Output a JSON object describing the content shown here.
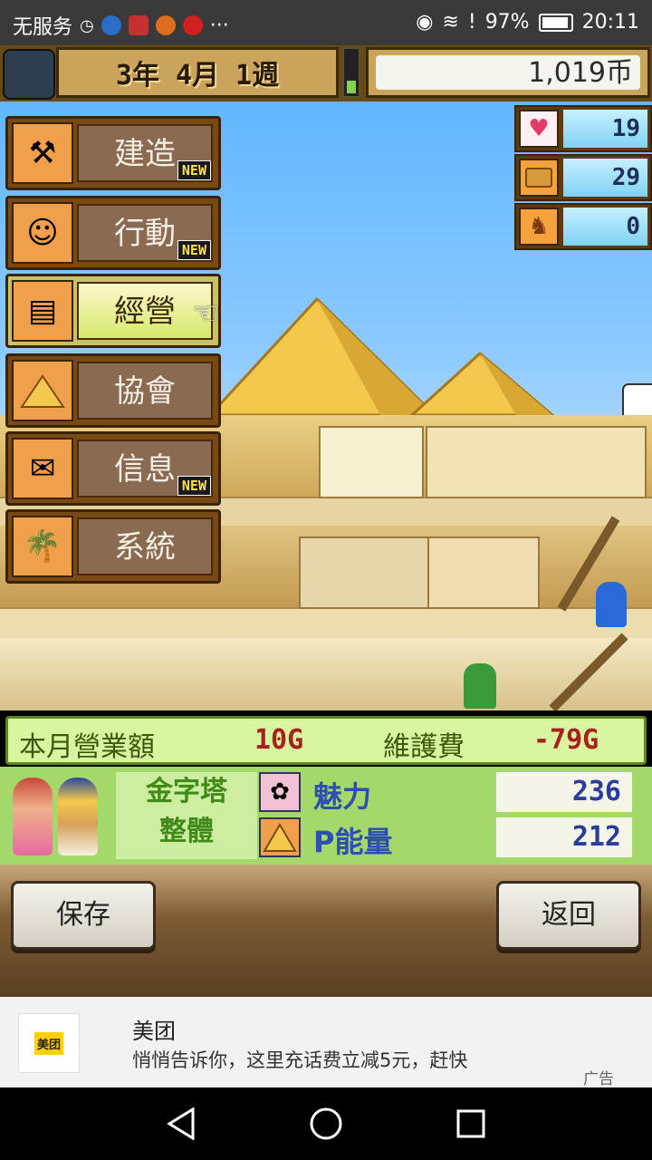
{
  "status_bar": {
    "carrier": "无服务",
    "battery": "97%",
    "time": "20:11",
    "more": "···"
  },
  "header": {
    "date_year": "3年",
    "date_month": "4月",
    "date_week": "1週",
    "coins": "1,019币"
  },
  "stats": [
    {
      "icon": "heart-icon",
      "value": "19"
    },
    {
      "icon": "bread-icon",
      "value": "29"
    },
    {
      "icon": "horse-icon",
      "value": "0"
    }
  ],
  "menu": [
    {
      "label": "建造",
      "new": "NEW",
      "icon": "hammer-icon"
    },
    {
      "label": "行動",
      "new": "NEW",
      "icon": "character-icon"
    },
    {
      "label": "經營",
      "new": "",
      "icon": "scroll-icon"
    },
    {
      "label": "協會",
      "new": "",
      "icon": "pyramid-icon"
    },
    {
      "label": "信息",
      "new": "NEW",
      "icon": "letter-icon"
    },
    {
      "label": "系統",
      "new": "",
      "icon": "island-icon"
    }
  ],
  "revenue": {
    "monthly_label": "本月營業額",
    "monthly_value": "10G",
    "maintenance_label": "維護費",
    "maintenance_value": "-79G"
  },
  "pyramid": {
    "name_line1": "金字塔",
    "name_line2": "整體",
    "charm_label": "魅力",
    "charm_value": "236",
    "energy_label": "P能量",
    "energy_value": "212"
  },
  "buttons": {
    "save": "保存",
    "back": "返回"
  },
  "ad": {
    "logo": "美团",
    "title": "美团",
    "text": "悄悄告诉你，这里充话费立减5元，赶快",
    "tag": "广告"
  },
  "colors": {
    "sky": "#62b7ff",
    "menu_brown": "#7a4a14",
    "active_yellow": "#d8e86a",
    "info_green": "#a5d86a"
  }
}
